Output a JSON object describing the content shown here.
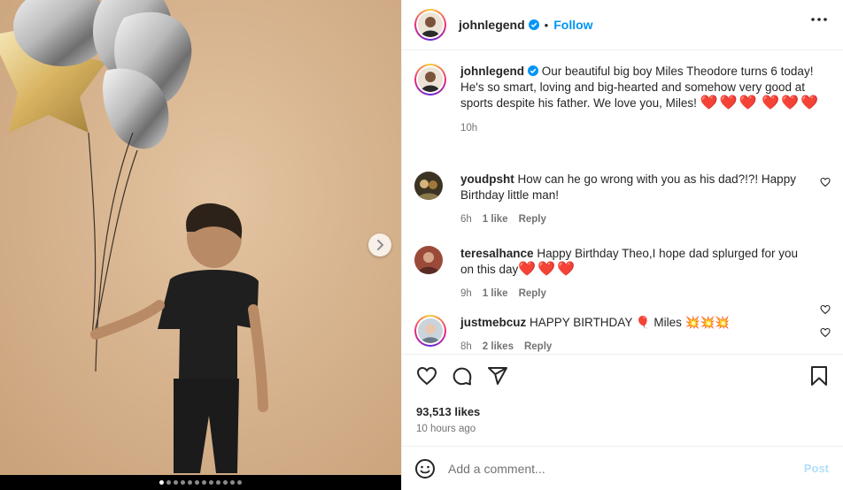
{
  "post": {
    "username": "johnlegend",
    "follow_label": "Follow",
    "separator": "•",
    "more_icon": "more-horizontal-icon",
    "verified_icon": "verified-badge-icon"
  },
  "caption": {
    "username": "johnlegend",
    "text": "Our beautiful big boy Miles Theodore turns 6 today! He's so smart, loving and big-hearted and somehow very good at sports despite his father. We love you, Miles!",
    "hearts_line1": "❤️❤️❤️",
    "hearts_line2": "❤️❤️❤️",
    "time": "10h"
  },
  "comments": [
    {
      "username": "youdpsht",
      "text": "How can he go wrong with you as his dad?!?! Happy Birthday little man!",
      "time": "6h",
      "likes": "1 like",
      "reply": "Reply"
    },
    {
      "username": "teresalhance",
      "text": "Happy Birthday Theo,I hope dad splurged for you on this day",
      "hearts": "❤️❤️❤️",
      "time": "9h",
      "likes": "1 like",
      "reply": "Reply"
    },
    {
      "username": "justmebcuz",
      "text_a": "HAPPY BIRTHDAY",
      "balloon": "🎈",
      "text_b": "Miles",
      "bursts": "💥💥💥",
      "time": "8h",
      "likes": "2 likes",
      "reply": "Reply"
    }
  ],
  "engagement": {
    "likes": "93,513 likes",
    "posted": "10 hours ago"
  },
  "composer": {
    "placeholder": "Add a comment...",
    "post_label": "Post"
  },
  "carousel": {
    "total": 12,
    "active_index": 0
  },
  "colors": {
    "accent": "#0095f6",
    "post_disabled": "#b2dffc",
    "heart_red": "#e0102c",
    "backdrop": "#d8b692"
  }
}
